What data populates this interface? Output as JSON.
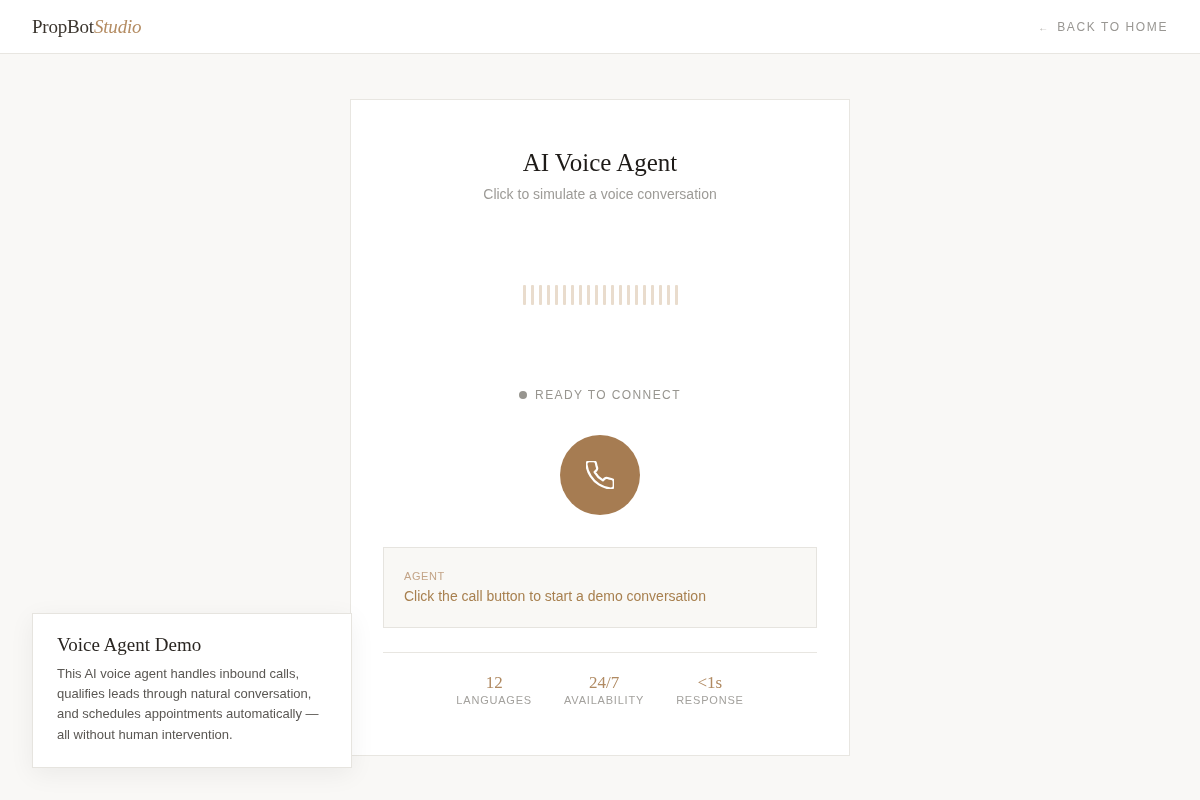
{
  "header": {
    "logo": {
      "name": "PropBot",
      "suffix": "Studio"
    },
    "back_link": {
      "arrow": "←",
      "label": "BACK TO HOME"
    }
  },
  "agent_card": {
    "title": "AI Voice Agent",
    "subtitle": "Click to simulate a voice conversation",
    "status": {
      "label": "READY TO CONNECT",
      "connected": false
    },
    "transcript": {
      "speaker": "AGENT",
      "message": "Click the call button to start a demo conversation"
    },
    "stats": [
      {
        "value": "12",
        "label": "LANGUAGES"
      },
      {
        "value": "24/7",
        "label": "AVAILABILITY"
      },
      {
        "value": "<1s",
        "label": "RESPONSE"
      }
    ]
  },
  "info_panel": {
    "title": "Voice Agent Demo",
    "body": "This AI voice agent handles inbound calls, qualifies leads through natural conversation, and schedules appointments automatically — all without human intervention."
  }
}
